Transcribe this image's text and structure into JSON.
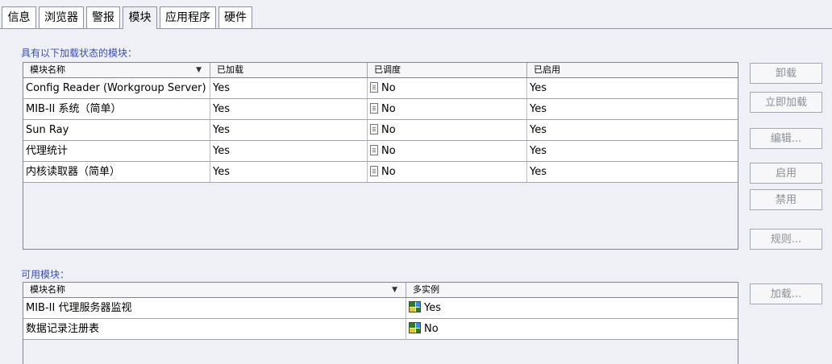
{
  "tabs": [
    "信息",
    "浏览器",
    "警报",
    "模块",
    "应用程序",
    "硬件"
  ],
  "loaded_section": {
    "label": "具有以下加载状态的模块：",
    "columns": [
      "模块名称",
      "已加载",
      "已调度",
      "已启用"
    ],
    "rows": [
      {
        "name": "Config Reader (Workgroup Server)",
        "loaded": "Yes",
        "scheduled": "No",
        "enabled": "Yes"
      },
      {
        "name": "MIB-II 系统（简单）",
        "loaded": "Yes",
        "scheduled": "No",
        "enabled": "Yes"
      },
      {
        "name": "Sun Ray",
        "loaded": "Yes",
        "scheduled": "No",
        "enabled": "Yes"
      },
      {
        "name": "代理统计",
        "loaded": "Yes",
        "scheduled": "No",
        "enabled": "Yes"
      },
      {
        "name": "内核读取器（简单）",
        "loaded": "Yes",
        "scheduled": "No",
        "enabled": "Yes"
      }
    ]
  },
  "available_section": {
    "label": "可用模块：",
    "columns": [
      "模块名称",
      "多实例"
    ],
    "rows": [
      {
        "name": "MIB-II 代理服务器监视",
        "multi": "Yes"
      },
      {
        "name": "数据记录注册表",
        "multi": "No"
      }
    ]
  },
  "buttons": {
    "unload": "卸载",
    "load_now": "立即加载",
    "edit": "编辑...",
    "enable": "启用",
    "disable": "禁用",
    "rules": "规则...",
    "load": "加载..."
  },
  "icons": {
    "scheduled": "document-icon",
    "multi_yes": "multi-instance-icon",
    "multi_no": "single-instance-icon"
  }
}
